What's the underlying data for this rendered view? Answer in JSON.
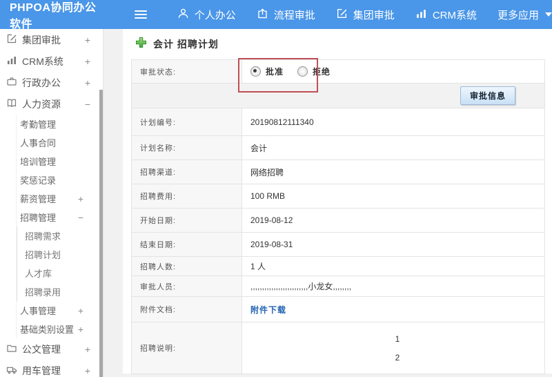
{
  "colors": {
    "header_blue": "#4a96e8",
    "annotation_red": "#bf4f55",
    "link_blue": "#2465b5",
    "plus_green": "#4caf50"
  },
  "header": {
    "logo": "PHPOA协同办公软件",
    "nav": [
      {
        "label": "个人办公",
        "icon": "user-icon"
      },
      {
        "label": "流程审批",
        "icon": "upload-icon"
      },
      {
        "label": "集团审批",
        "icon": "edit-square-icon"
      },
      {
        "label": "CRM系统",
        "icon": "bar-chart-icon"
      },
      {
        "label": "更多应用",
        "icon": "caret-down-icon"
      }
    ]
  },
  "sidebar": {
    "items": [
      {
        "label": "集团审批",
        "expander": "+"
      },
      {
        "label": "CRM系统",
        "expander": "+"
      },
      {
        "label": "行政办公",
        "expander": "+"
      },
      {
        "label": "人力资源",
        "expander": "−"
      },
      {
        "label": "考勤管理",
        "expander": ""
      },
      {
        "label": "人事合同",
        "expander": ""
      },
      {
        "label": "培训管理",
        "expander": ""
      },
      {
        "label": "奖惩记录",
        "expander": ""
      },
      {
        "label": "薪资管理",
        "expander": "+"
      },
      {
        "label": "招聘管理",
        "expander": "−"
      },
      {
        "label": "招聘需求",
        "expander": ""
      },
      {
        "label": "招聘计划",
        "expander": ""
      },
      {
        "label": "人才库",
        "expander": ""
      },
      {
        "label": "招聘录用",
        "expander": ""
      },
      {
        "label": "人事管理",
        "expander": "+"
      },
      {
        "label": "基础类别设置",
        "expander": "+"
      },
      {
        "label": "公文管理",
        "expander": "+"
      },
      {
        "label": "用车管理",
        "expander": "+"
      }
    ]
  },
  "main": {
    "title": "会计 招聘计划",
    "approval_status": {
      "label": "审批状态:",
      "options": [
        {
          "label": "批准",
          "selected": true
        },
        {
          "label": "拒绝",
          "selected": false
        }
      ]
    },
    "approval_info_button": "审批信息",
    "rows": [
      {
        "label": "计划编号:",
        "value": "20190812111340"
      },
      {
        "label": "计划名称:",
        "value": "会计"
      },
      {
        "label": "招聘渠道:",
        "value": "网络招聘"
      },
      {
        "label": "招聘费用:",
        "value": "100 RMB"
      },
      {
        "label": "开始日期:",
        "value": "2019-08-12"
      },
      {
        "label": "结束日期:",
        "value": "2019-08-31"
      },
      {
        "label": "招聘人数:",
        "value": "1 人"
      },
      {
        "label": "审批人员:",
        "value": ",,,,,,,,,,,,,,,,,,,,,,,,,小龙女,,,,,,,,"
      },
      {
        "label": "附件文档:",
        "value": "附件下载"
      },
      {
        "label": "招聘说明:",
        "line1": "1",
        "line2": "2"
      }
    ]
  }
}
